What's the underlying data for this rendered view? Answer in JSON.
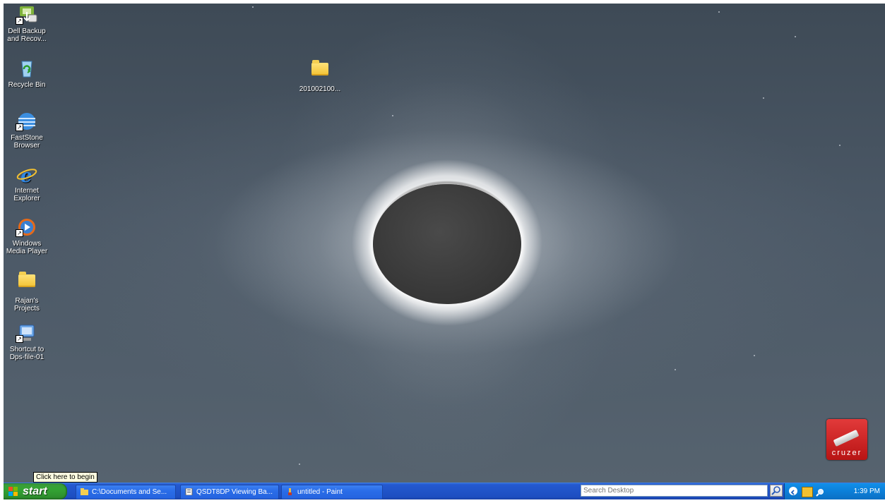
{
  "desktop": {
    "icons": [
      {
        "label": "Dell Backup and Recov...",
        "type": "shortcut"
      },
      {
        "label": "Recycle Bin",
        "type": "system"
      },
      {
        "label": "FastStone Browser",
        "type": "shortcut"
      },
      {
        "label": "Internet Explorer",
        "type": "system"
      },
      {
        "label": "Windows Media Player",
        "type": "shortcut"
      },
      {
        "label": "Rajan's Projects",
        "type": "folder"
      },
      {
        "label": "Shortcut to Dps-file-01",
        "type": "shortcut"
      }
    ],
    "folder": {
      "label": "201002100..."
    },
    "cruzer": {
      "label": "cruzer"
    }
  },
  "tooltip": {
    "text": "Click here to begin"
  },
  "taskbar": {
    "start_label": "start",
    "tasks": [
      {
        "label": "C:\\Documents and Se...",
        "icon": "folder-icon"
      },
      {
        "label": "QSDT8DP Viewing Ba...",
        "icon": "document-icon"
      },
      {
        "label": "untitled - Paint",
        "icon": "paint-icon"
      }
    ],
    "search_placeholder": "Search Desktop",
    "clock": "1:39 PM"
  },
  "colors": {
    "taskbar": "#2459d0",
    "start_button": "#34a534",
    "tray": "#0c7fd8"
  }
}
